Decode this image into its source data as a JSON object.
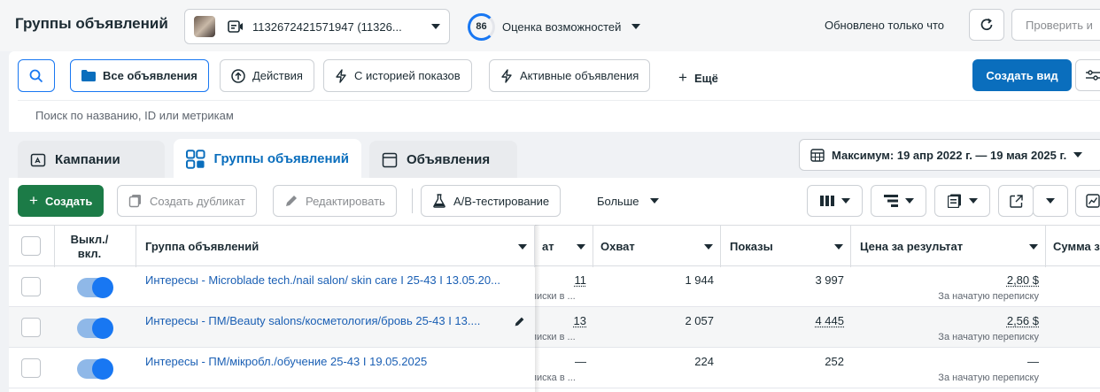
{
  "header": {
    "title": "Группы объявлений",
    "account_label": "1132672421571947 (11326...",
    "score_value": "86",
    "score_label": "Оценка возможностей",
    "updated_text": "Обновлено только что",
    "check_label": "Проверить и"
  },
  "filters": {
    "all_ads": "Все объявления",
    "actions": "Действия",
    "with_history": "С историей показов",
    "active_ads": "Активные объявления",
    "more": "Ещё",
    "create_view": "Создать вид",
    "search_placeholder": "Поиск по названию, ID или метрикам"
  },
  "tabs": [
    {
      "label": "Кампании",
      "icon": "campaign-icon"
    },
    {
      "label": "Группы объявлений",
      "icon": "grid-icon"
    },
    {
      "label": "Объявления",
      "icon": "ad-icon"
    }
  ],
  "date_range": "Максимум: 19 апр 2022 г. — 19 мая 2025 г.",
  "toolbar": {
    "create": "Создать",
    "duplicate": "Создать дубликат",
    "edit": "Редактировать",
    "ab_test": "A/B-тестирование",
    "more": "Больше"
  },
  "table": {
    "columns": {
      "toggle": "Выкл./ вкл.",
      "name": "Группа объявлений",
      "results": "ат",
      "reach": "Охват",
      "impressions": "Показы",
      "cost_per_result": "Цена за результат",
      "amount_spent": "Сумма з"
    },
    "rows": [
      {
        "name": "Интересы - Microblade tech./nail salon/ skin care I 25-43 I 13.05.20...",
        "results": "11",
        "results_sub": "писки в ...",
        "reach": "1 944",
        "impressions": "3 997",
        "cost": "2,80 $",
        "cost_sub": "За начатую переписку"
      },
      {
        "name": "Интересы - ПМ/Beauty salons/косметология/бровь 25-43 I 13....",
        "results": "13",
        "results_sub": "писки в ...",
        "reach": "2 057",
        "impressions": "4 445",
        "cost": "2,56 $",
        "cost_sub": "За начатую переписку"
      },
      {
        "name": "Интересы - ПМ/мікробл./обучение 25-43 I 19.05.2025",
        "results": "—",
        "results_sub": "писка в ...",
        "reach": "224",
        "impressions": "252",
        "cost": "—",
        "cost_sub": "За начатую переписку"
      }
    ]
  },
  "colors": {
    "primary": "#0a6ebd",
    "create_green": "#1c7b47",
    "link": "#1a5fb4",
    "toggle_on": "#1877f2"
  }
}
